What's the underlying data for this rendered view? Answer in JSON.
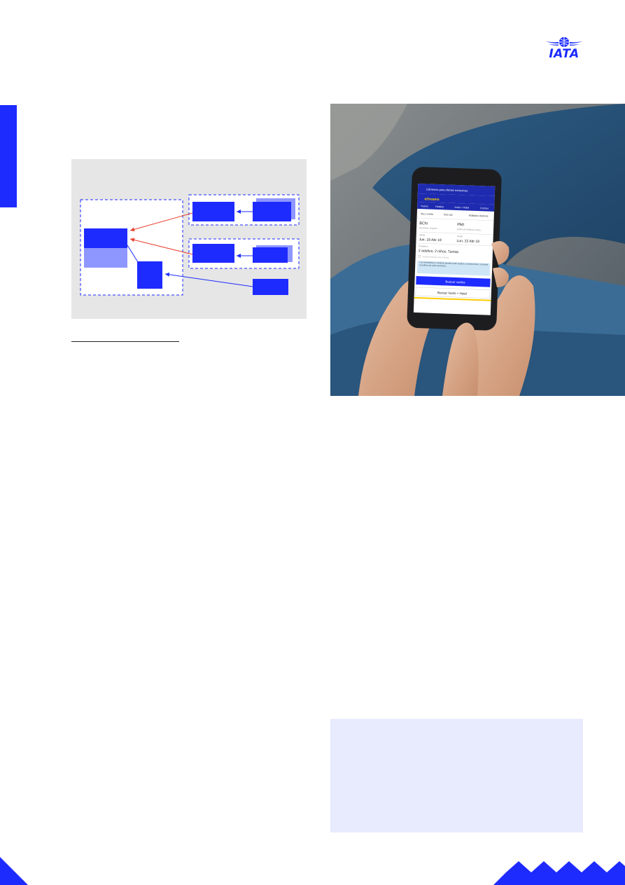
{
  "logo": {
    "text": "IATA",
    "icon": "globe-wings-icon",
    "color": "#1a2bff"
  },
  "colors": {
    "brand_blue": "#1e2bff",
    "light_blue": "#8e96ff",
    "red_arrow": "#e8412f",
    "panel_grey": "#e6e6e6",
    "callout_bg": "#e8eafd"
  },
  "phone_app": {
    "banner": "Llámenos para ofertas exclusivas",
    "brand": "eDreams",
    "tabs": [
      "Vuelos",
      "Hoteles",
      "Vuelo + Hotel",
      "Coches"
    ],
    "trip_types": [
      "Ida y vuelta",
      "Solo ida",
      "Múltiples destinos"
    ],
    "origin_code": "BCN",
    "origin_name": "Barcelona, España",
    "destination_code": "PMI",
    "destination_name": "Palma de Mallorca, Espa...",
    "depart_label": "Salida",
    "depart_date": "Jue, 18 Abr 19",
    "return_label": "Vuelta",
    "return_date": "Lun, 22 Abr 19",
    "passengers_label": "Pasajeros",
    "passengers": "2 adultos, 2 niños, Turista",
    "checkbox_label": "Vuelos directos solo mostrar",
    "notice_text": "Los reembolsos y cambios pueden estar sujetos a restricciones. Consulte la política de cada aerolínea.",
    "search_flights": "Buscar vuelos",
    "search_flight_hotel": "Buscar Vuelo + Hotel"
  }
}
